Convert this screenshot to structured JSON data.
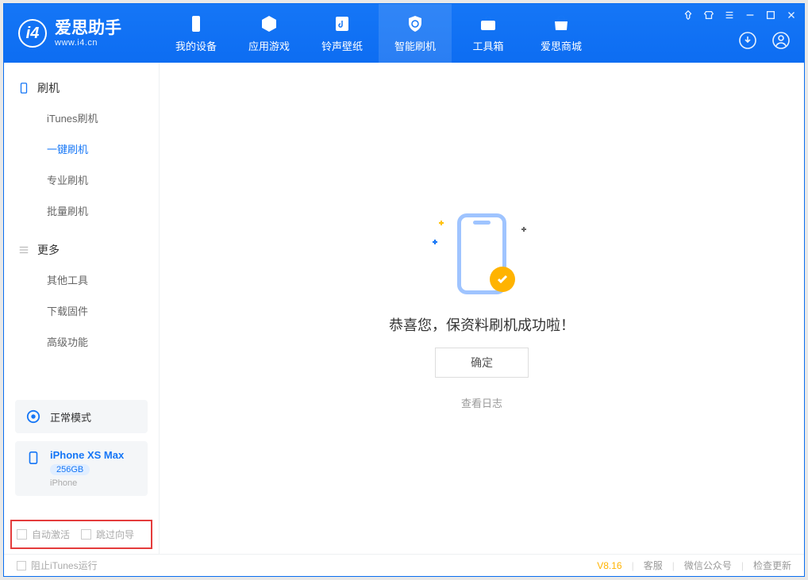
{
  "app": {
    "title": "爱思助手",
    "subtitle": "www.i4.cn"
  },
  "nav": {
    "items": [
      {
        "label": "我的设备"
      },
      {
        "label": "应用游戏"
      },
      {
        "label": "铃声壁纸"
      },
      {
        "label": "智能刷机"
      },
      {
        "label": "工具箱"
      },
      {
        "label": "爱思商城"
      }
    ]
  },
  "sidebar": {
    "flash_group": "刷机",
    "flash_items": [
      "iTunes刷机",
      "一键刷机",
      "专业刷机",
      "批量刷机"
    ],
    "more_group": "更多",
    "more_items": [
      "其他工具",
      "下载固件",
      "高级功能"
    ]
  },
  "device": {
    "mode": "正常模式",
    "name": "iPhone XS Max",
    "storage": "256GB",
    "type": "iPhone"
  },
  "checkboxes": {
    "auto_activate": "自动激活",
    "skip_guide": "跳过向导"
  },
  "main": {
    "success_text": "恭喜您，保资料刷机成功啦！",
    "confirm": "确定",
    "view_log": "查看日志"
  },
  "status": {
    "block_itunes": "阻止iTunes运行",
    "version": "V8.16",
    "support": "客服",
    "wechat": "微信公众号",
    "update": "检查更新"
  }
}
